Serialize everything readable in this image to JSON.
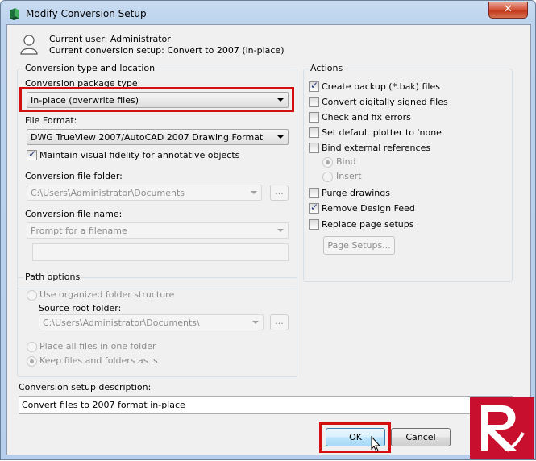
{
  "window": {
    "title": "Modify Conversion Setup",
    "close_glyph": "✕"
  },
  "user_info": {
    "current_user": "Current user: Administrator",
    "current_setup": "Current conversion setup: Convert to 2007 (in-place)"
  },
  "conversion_group": {
    "title": "Conversion type and location",
    "package_type_label": "Conversion package type:",
    "package_type_value": "In-place (overwrite files)",
    "file_format_label": "File Format:",
    "file_format_value": "DWG TrueView 2007/AutoCAD 2007 Drawing Format",
    "maintain_fidelity_label": "Maintain visual fidelity for annotative objects",
    "maintain_fidelity_checked": true,
    "folder_label": "Conversion file folder:",
    "folder_value": "C:\\Users\\Administrator\\Documents",
    "browse_label": "...",
    "file_name_label": "Conversion file name:",
    "file_name_value": "Prompt for a filename",
    "file_name_text": ""
  },
  "path_group": {
    "title": "Path options",
    "organized_label": "Use organized folder structure",
    "source_root_label": "Source root folder:",
    "source_root_value": "C:\\Users\\Administrator\\Documents\\",
    "browse_label": "...",
    "place_all_label": "Place all files in one folder",
    "keep_as_is_label": "Keep files and folders as is",
    "selected": "keep_as_is"
  },
  "actions_group": {
    "title": "Actions",
    "items": [
      {
        "label": "Create backup (*.bak) files",
        "checked": true
      },
      {
        "label": "Convert digitally signed files",
        "checked": false
      },
      {
        "label": "Check and fix errors",
        "checked": false
      },
      {
        "label": "Set default plotter to 'none'",
        "checked": false
      },
      {
        "label": "Bind external references",
        "checked": false
      }
    ],
    "bind_label": "Bind",
    "insert_label": "Insert",
    "bind_selected": "bind",
    "items2": [
      {
        "label": "Purge drawings",
        "checked": false
      },
      {
        "label": "Remove Design Feed",
        "checked": true
      },
      {
        "label": "Replace page setups",
        "checked": false
      }
    ],
    "page_setups_label": "Page Setups..."
  },
  "description": {
    "label": "Conversion setup description:",
    "value": "Convert files to 2007 format in-place"
  },
  "buttons": {
    "ok": "OK",
    "cancel": "Cancel"
  },
  "colors": {
    "highlight": "#d40f0f",
    "titlebar": "#c9dcf1",
    "logo_bg": "#c8102e"
  }
}
